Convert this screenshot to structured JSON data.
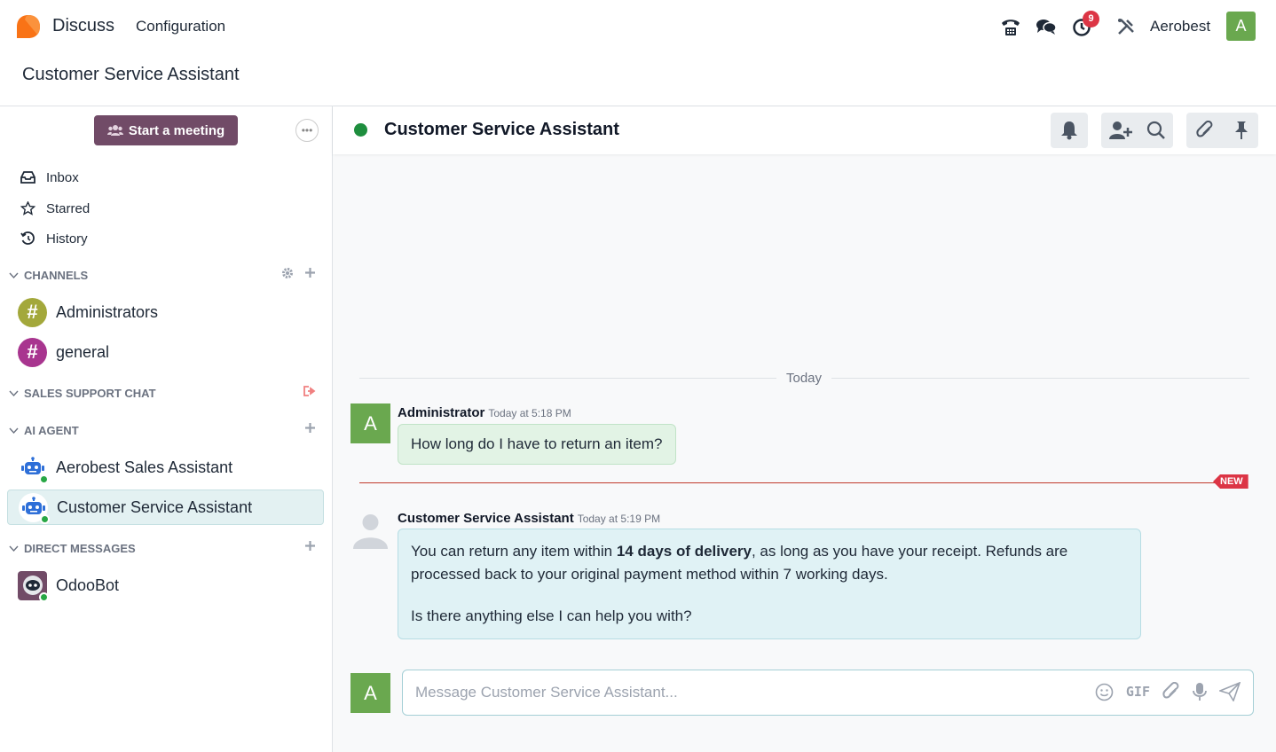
{
  "topbar": {
    "app_name": "Discuss",
    "menu_configuration": "Configuration",
    "activity_badge": "9",
    "company": "Aerobest",
    "user_initial": "A"
  },
  "breadcrumb": "Customer Service Assistant",
  "sidebar": {
    "start_meeting": "Start a meeting",
    "nav": [
      "Inbox",
      "Starred",
      "History"
    ],
    "categories": {
      "channels": "CHANNELS",
      "sales_support": "SALES SUPPORT CHAT",
      "ai_agent": "AI AGENT",
      "direct_messages": "DIRECT MESSAGES"
    },
    "channels": [
      "Administrators",
      "general"
    ],
    "ai_agents": [
      "Aerobest Sales Assistant",
      "Customer Service Assistant"
    ],
    "direct_messages": [
      "OdooBot"
    ]
  },
  "thread": {
    "title": "Customer Service Assistant",
    "date_separator": "Today",
    "messages": [
      {
        "author": "Administrator",
        "time": "Today at 5:18 PM",
        "avatar": "A",
        "text": "How long do I have to return an item?"
      },
      {
        "author": "Customer Service Assistant",
        "time": "Today at 5:19 PM",
        "text_part1": "You can return any item within ",
        "text_bold": "14 days of delivery",
        "text_part2": ", as long as you have your receipt. Refunds are processed back to your original payment method within 7 working days.",
        "text_para2": "Is there anything else I can help you with?"
      }
    ],
    "new_tag": "NEW"
  },
  "composer": {
    "avatar": "A",
    "placeholder": "Message Customer Service Assistant...",
    "gif_label": "GIF"
  },
  "colors": {
    "brand": "#714b67",
    "online": "#28a745",
    "danger": "#dc3545",
    "avatar_green": "#6aa84f"
  }
}
